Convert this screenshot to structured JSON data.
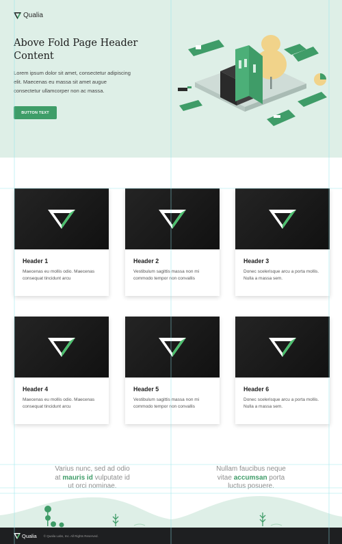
{
  "brand": {
    "name": "Qualia",
    "accent": "#3e9d68",
    "hero_bg": "#deefe7",
    "footer_bg": "#1e1f21"
  },
  "hero": {
    "title": "Above Fold Page Header Content",
    "body": "Lorem ipsum dolor sit amet, consectetur adipiscing elit. Maecenas eu massa sit amet augue consectetur ullamcorper non ac massa.",
    "button_label": "BUTTON TEXT"
  },
  "cards": [
    {
      "title": "Header 1",
      "text": "Maecenas eu mollis odio. Maecenas consequat tincidunt arcu"
    },
    {
      "title": "Header 2",
      "text": "Vestibulum sagittis massa non mi commodo tempor non convallis"
    },
    {
      "title": "Header 3",
      "text": "Donec scelerisque arcu a porta mollis. Nulla a massa sem."
    },
    {
      "title": "Header 4",
      "text": "Maecenas eu mollis odio. Maecenas consequat tincidunt arcu"
    },
    {
      "title": "Header 5",
      "text": "Vestibulum sagittis massa non mi commodo tempor non convallis"
    },
    {
      "title": "Header 6",
      "text": "Donec scelerisque arcu a porta mollis. Nulla a massa sem."
    }
  ],
  "quotes": [
    {
      "line1": "Varius nunc, sed ad odio",
      "pre": "at ",
      "highlight": "mauris id",
      "post": " vulputate id",
      "line3": "ut orci nominae."
    },
    {
      "line1": "Nullam faucibus neque",
      "pre": "vitae ",
      "highlight": "accumsan",
      "post": " porta",
      "line3": "luctus posuere."
    }
  ],
  "footer": {
    "brand": "Qualia",
    "copyright": "© Qualia Labs, Inc. All Rights Reserved."
  },
  "icons": {
    "logo": "qualia-v-logo-icon"
  }
}
